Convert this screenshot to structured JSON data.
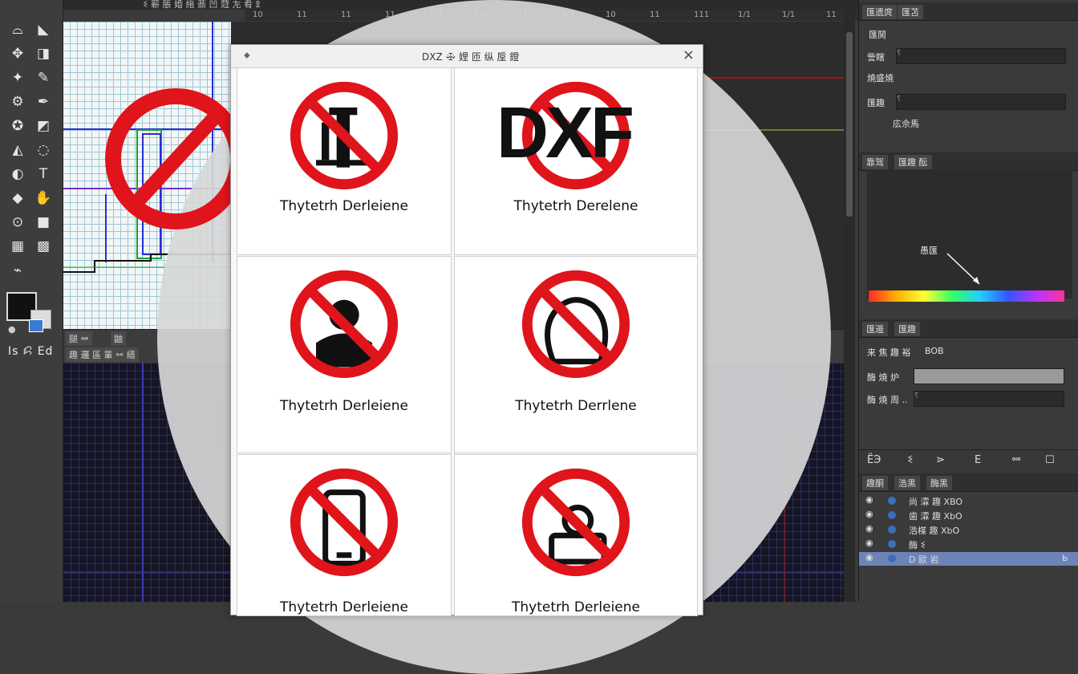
{
  "colors": {
    "prohibit_red": "#e0141b",
    "dialog_bg": "#f7f7f7",
    "panel_bg": "#3a3a3a",
    "selected_layer": "#6d84b8"
  },
  "top_bar": {
    "tab_label": "ꗨ 蕲 脹 婚 絁 薡 凹 蒄 㔫 肴 ꖵ",
    "ruler_ticks": [
      "10",
      "11",
      "11",
      "11",
      "1 0",
      "1/0",
      "11",
      "1/1",
      "10",
      "11",
      "111",
      "1/1",
      "1/1",
      "11"
    ]
  },
  "toolbar": {
    "icons": [
      "lasso-icon",
      "arrow-icon",
      "move-icon",
      "crop-icon",
      "wand-icon",
      "brush-icon",
      "gear-icon",
      "pen-icon",
      "stamp-icon",
      "eraser-icon",
      "fill-icon",
      "blur-icon",
      "dodge-icon",
      "type-icon",
      "shape-icon",
      "hand-icon",
      "zoom-icon",
      "rect-icon",
      "select-icon",
      "grid-icon",
      "eyedropper-icon"
    ],
    "bottom_label": "Is ꗲ Ed"
  },
  "mid_strip": {
    "tabs": [
      "腿 ꗮ",
      "鼬",
      "趣 邏 區 輩 ꗬ 縉"
    ]
  },
  "dialog": {
    "title": "DXZ ꗾ 娌 匝 纵 垕 鐙",
    "close_label": "×",
    "pin_label": "⬥",
    "items": [
      {
        "label": "Thytetrh Derleiene",
        "symbol": "tool"
      },
      {
        "label": "Thytetrh Derelene",
        "symbol": "dxf",
        "overlay_text": "DXF"
      },
      {
        "label": "Thytetrh Derleiene",
        "symbol": "person"
      },
      {
        "label": "Thytetrh Derrlene",
        "symbol": "bag"
      },
      {
        "label": "Thytetrh Derleiene",
        "symbol": "phone"
      },
      {
        "label": "Thytetrh Derleiene",
        "symbol": "user-box"
      }
    ]
  },
  "right_panel": {
    "top_tabs": [
      "匯遗庹",
      "匯苫"
    ],
    "section1_label": "匯鬨",
    "field1_label": "訾瞎",
    "field1_value": "⸮",
    "field1_note": "焼盛焼",
    "field2_label": "匯趣",
    "field2_value": "⸮",
    "field2_note": "庅佘馬",
    "color_tabs": [
      "靠驾",
      "匯趣 酝"
    ],
    "color_tip": "愚匯",
    "props_tabs": [
      "匯邊",
      "匯趣"
    ],
    "prop1_label": "来 焦 趣 裕",
    "prop1_value": "BOB",
    "prop2_label": "酶 焼 炉",
    "prop3_label": "酶 焼 周 ..",
    "prop3_value": "⸮",
    "icon_row": [
      "fx-icon",
      "mask-icon",
      "adjust-icon",
      "group-icon",
      "new-layer-icon",
      "trash-icon"
    ],
    "icon_row_labels": [
      "ЁЭ",
      "ꗨ",
      "⋗",
      "E",
      "ꗮ",
      "☐"
    ],
    "layers_tabs": [
      "趣酮",
      "浩黑",
      "酶黑"
    ],
    "layers": [
      {
        "name": "尚 瀮 趣 XBO",
        "selected": false
      },
      {
        "name": "歯 瀮 趣 XbO",
        "selected": false
      },
      {
        "name": "浩楳 趣 XbO",
        "selected": false
      },
      {
        "name": "酶 ꗨ",
        "selected": false
      },
      {
        "name": "D 歐 岩",
        "selected": true,
        "badge": "ᖯ"
      }
    ]
  }
}
